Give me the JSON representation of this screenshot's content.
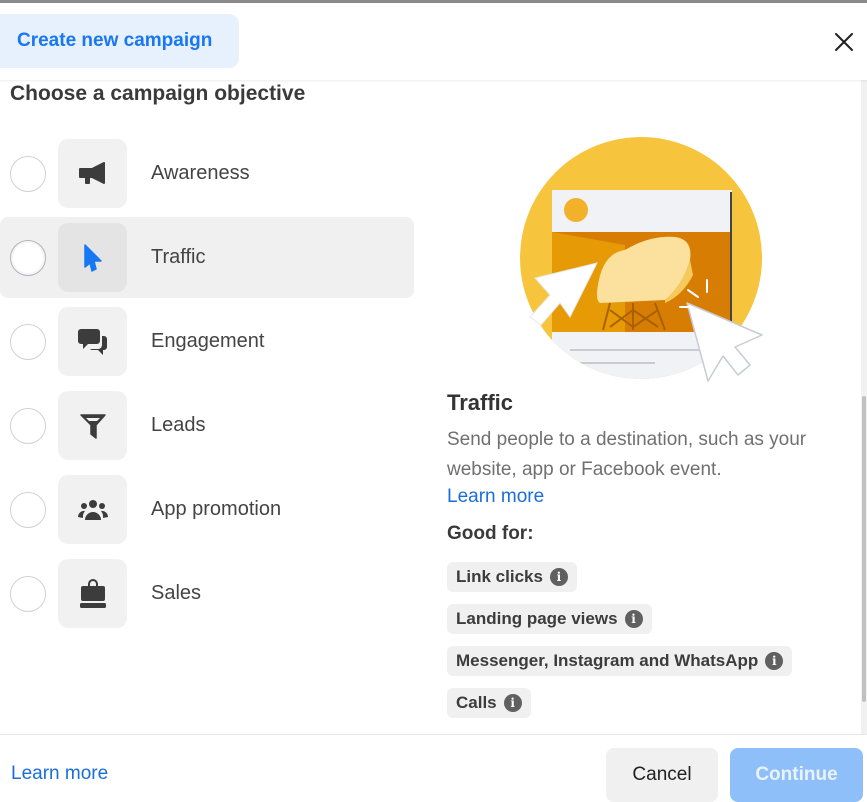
{
  "header": {
    "tab_label": "Create new campaign",
    "close_icon": "close-icon"
  },
  "main": {
    "section_title": "Choose a campaign objective",
    "options": [
      {
        "label": "Awareness",
        "icon": "megaphone-icon",
        "selected": false
      },
      {
        "label": "Traffic",
        "icon": "cursor-icon",
        "selected": false,
        "highlighted": true
      },
      {
        "label": "Engagement",
        "icon": "chat-bubbles-icon",
        "selected": false
      },
      {
        "label": "Leads",
        "icon": "funnel-icon",
        "selected": false
      },
      {
        "label": "App promotion",
        "icon": "people-group-icon",
        "selected": false
      },
      {
        "label": "Sales",
        "icon": "shopping-bag-icon",
        "selected": false
      }
    ]
  },
  "detail": {
    "title": "Traffic",
    "description": "Send people to a destination, such as your website, app or Facebook event.",
    "learn_more": "Learn more",
    "good_for_label": "Good for:",
    "good_for": [
      {
        "label": "Link clicks",
        "icon": "info-icon"
      },
      {
        "label": "Landing page views",
        "icon": "info-icon"
      },
      {
        "label": "Messenger, Instagram and WhatsApp",
        "icon": "info-icon"
      },
      {
        "label": "Calls",
        "icon": "info-icon"
      }
    ],
    "info_glyph": "i"
  },
  "footer": {
    "learn_more": "Learn more",
    "cancel": "Cancel",
    "continue": "Continue"
  },
  "colors": {
    "accent": "#1877f2",
    "link": "#1a6ed8",
    "continue_disabled": "#8fbff8",
    "tab_bg": "#e7f0fd",
    "illustration_yellow": "#f7c53d"
  }
}
